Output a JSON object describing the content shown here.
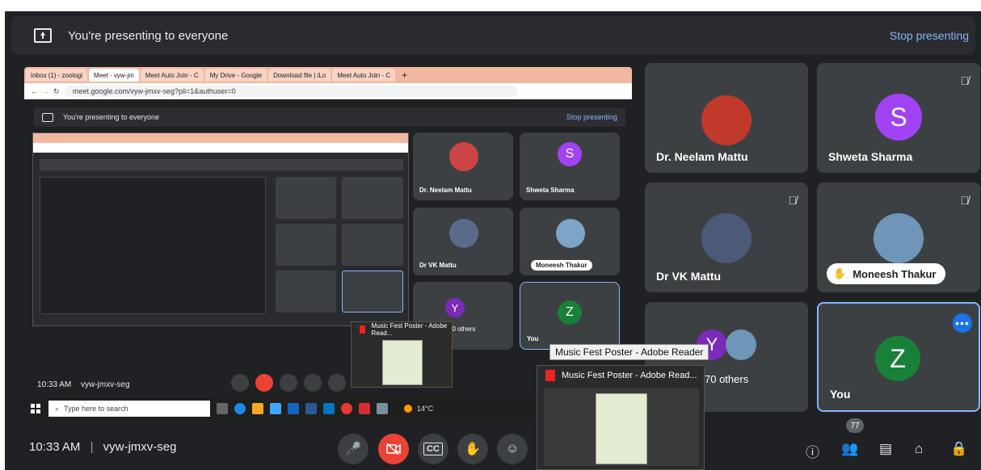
{
  "topbar": {
    "presenting_text": "You're presenting to everyone",
    "stop_label": "Stop presenting"
  },
  "participants": [
    {
      "name": "Dr. Neelam Mattu",
      "type": "photo"
    },
    {
      "name": "Shweta Sharma",
      "type": "avatar",
      "initial": "S",
      "color": "#a142f4"
    },
    {
      "name": "Dr VK Mattu",
      "type": "photo"
    },
    {
      "name": "Moneesh Thakur",
      "type": "photo",
      "hand_raised": true
    },
    {
      "name": "70 others",
      "type": "others",
      "initial": "Y",
      "color": "#7b2bb8"
    },
    {
      "name": "You",
      "type": "avatar",
      "initial": "Z",
      "color": "#188038"
    }
  ],
  "browser": {
    "tabs": [
      "Inbox (1) - zoologi",
      "Meet - vyw-jm",
      "Meet Auto Join - C",
      "My Drive - Google",
      "Download file | iLo",
      "Meet Auto Join - C"
    ],
    "url": "meet.google.com/vyw-jmxv-seg?pli=1&authuser=0"
  },
  "inner": {
    "presenting_text": "You're presenting to everyone",
    "stop_label": "Stop presenting",
    "names": [
      "Dr. Neelam Mattu",
      "Shweta Sharma",
      "Dr VK Mattu",
      "Moneesh Thakur",
      "70 others",
      "You"
    ]
  },
  "inner_bottom": {
    "clock": "10:33 AM",
    "meeting_code": "vyw-jmxv-seg"
  },
  "taskbar": {
    "search_placeholder": "Type here to search",
    "weather": "14°C"
  },
  "popup": {
    "tooltip": "Music Fest Poster - Adobe Reader",
    "title": "Music Fest Poster - Adobe Read..."
  },
  "bottom": {
    "clock": "10:33 AM",
    "separator": "|",
    "meeting_code": "vyw-jmxv-seg",
    "participant_count": "77"
  }
}
